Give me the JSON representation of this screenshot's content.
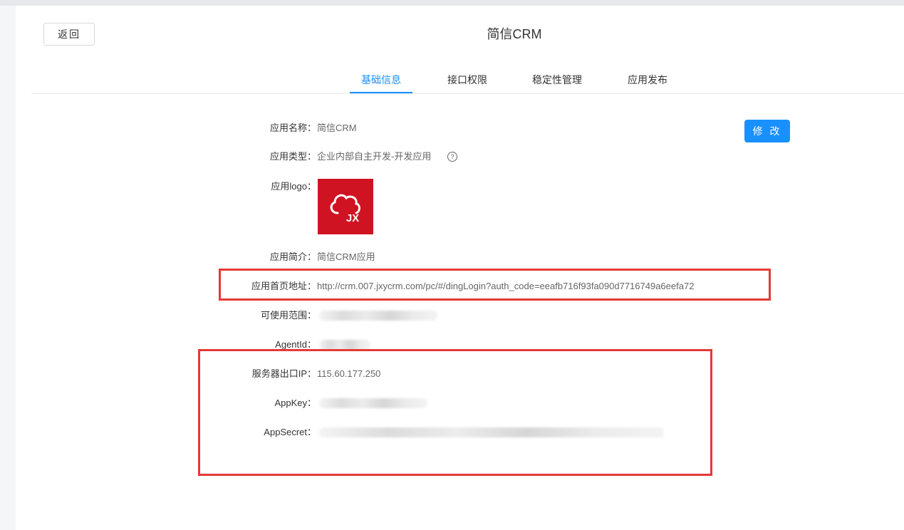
{
  "header": {
    "back_label": "返回",
    "app_title": "简信CRM"
  },
  "tabs": [
    {
      "label": "基础信息",
      "active": true
    },
    {
      "label": "接口权限",
      "active": false
    },
    {
      "label": "稳定性管理",
      "active": false
    },
    {
      "label": "应用发布",
      "active": false
    }
  ],
  "actions": {
    "edit_label": "修 改"
  },
  "fields": {
    "name": {
      "label": "应用名称：",
      "value": "简信CRM"
    },
    "type": {
      "label": "应用类型：",
      "value": "企业内部自主开发-开发应用"
    },
    "logo": {
      "label": "应用logo：",
      "logo_text": "JX"
    },
    "intro": {
      "label": "应用简介：",
      "value": "简信CRM应用"
    },
    "homepage": {
      "label": "应用首页地址：",
      "value": "http://crm.007.jxycrm.com/pc/#/dingLogin?auth_code=eeafb716f93fa090d7716749a6eefa72"
    },
    "scope": {
      "label": "可使用范围："
    },
    "agentid": {
      "label": "AgentId："
    },
    "server_ip": {
      "label": "服务器出口IP：",
      "value": "115.60.177.250"
    },
    "appkey": {
      "label": "AppKey："
    },
    "appsecret": {
      "label": "AppSecret："
    }
  },
  "icons": {
    "help": "question-circle-icon",
    "logo": "cloud-jx-logo"
  },
  "colors": {
    "accent": "#1890ff",
    "logo_bg": "#cf1322",
    "highlight_box": "#e53935"
  }
}
